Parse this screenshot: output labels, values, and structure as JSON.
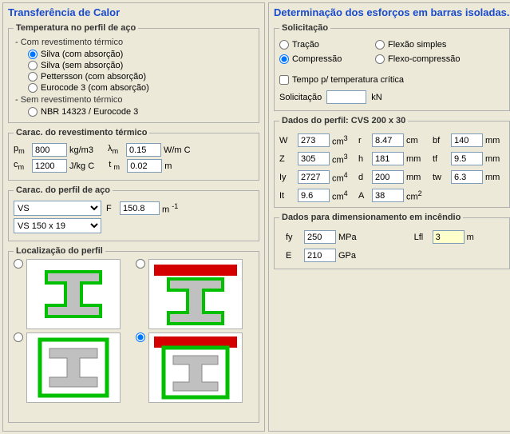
{
  "left": {
    "title": "Transferência de Calor",
    "tempGroup": {
      "legend": "Temperatura no perfil de aço",
      "withCoating": "- Com revestimento térmico",
      "optSilvaAbs": "Silva (com absorção)",
      "optSilvaNoAbs": "Silva (sem absorção)",
      "optPettersson": "Pettersson (com absorção)",
      "optEurocode": "Eurocode 3 (com absorção)",
      "withoutCoating": "- Sem revestimento térmico",
      "optNBR": "NBR 14323 / Eurocode 3"
    },
    "coatingGroup": {
      "legend": "Carac. do revestimento térmico",
      "pm_label": "p",
      "pm_sub": "m",
      "pm_val": "800",
      "pm_unit": "kg/m3",
      "lambda_label": "λ",
      "lambda_sub": "m",
      "lambda_val": "0.15",
      "lambda_unit": "W/m C",
      "cm_label": "c",
      "cm_sub": "m",
      "cm_val": "1200",
      "cm_unit": "J/kg C",
      "tm_label": "t",
      "tm_sub": "m",
      "tm_val": "0.02",
      "tm_unit": "m"
    },
    "steelGroup": {
      "legend": "Carac. do perfil de aço",
      "series": "VS",
      "profile": "VS 150 x 19",
      "F_label": "F",
      "F_val": "150.8",
      "F_unit": "m",
      "F_exp": "-1"
    },
    "locGroup": {
      "legend": "Localização do perfil"
    }
  },
  "right": {
    "title": "Determinação dos esforços em barras isoladas.",
    "solicitGroup": {
      "legend": "Solicitação",
      "tracao": "Tração",
      "compressao": "Compressão",
      "flexao": "Flexão simples",
      "flexocomp": "Flexo-compressão",
      "tempoCritico": "Tempo p/ temperatura crítica",
      "solicitLabel": "Solicitação",
      "solicitVal": "",
      "solicitUnit": "kN"
    },
    "profileGroup": {
      "legend": "Dados do perfil: CVS 200 x 30",
      "W_lab": "W",
      "W_val": "273",
      "W_unit": "cm",
      "W_exp": "3",
      "r_lab": "r",
      "r_val": "8.47",
      "r_unit": "cm",
      "bf_lab": "bf",
      "bf_val": "140",
      "bf_unit": "mm",
      "Z_lab": "Z",
      "Z_val": "305",
      "Z_unit": "cm",
      "Z_exp": "3",
      "h_lab": "h",
      "h_val": "181",
      "h_unit": "mm",
      "tf_lab": "tf",
      "tf_val": "9.5",
      "tf_unit": "mm",
      "Iy_lab": "Iy",
      "Iy_val": "2727",
      "Iy_unit": "cm",
      "Iy_exp": "4",
      "d_lab": "d",
      "d_val": "200",
      "d_unit": "mm",
      "tw_lab": "tw",
      "tw_val": "6.3",
      "tw_unit": "mm",
      "It_lab": "It",
      "It_val": "9.6",
      "It_unit": "cm",
      "It_exp": "4",
      "A_lab": "A",
      "A_val": "38",
      "A_unit": "cm",
      "A_exp": "2"
    },
    "designGroup": {
      "legend": "Dados para dimensionamento em incêndio",
      "fy_lab": "fy",
      "fy_val": "250",
      "fy_unit": "MPa",
      "Lfl_lab": "Lfl",
      "Lfl_val": "3",
      "Lfl_unit": "m",
      "E_lab": "E",
      "E_val": "210",
      "E_unit": "GPa"
    }
  }
}
